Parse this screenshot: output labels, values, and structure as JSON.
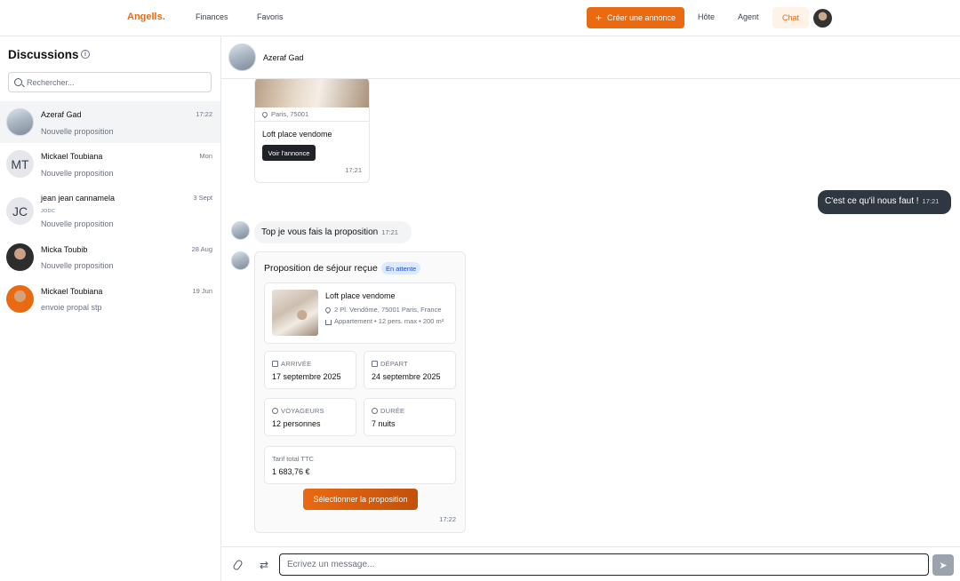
{
  "nav": {
    "logo": "Angells.",
    "links": [
      "Finances",
      "Favoris"
    ],
    "create_label": "Créer une annonce",
    "hote": "Hôte",
    "agent": "Agent",
    "chat": "Chat",
    "accent_color": "#ea6a12"
  },
  "sidebar": {
    "title": "Discussions",
    "search_placeholder": "Rechercher...",
    "conversations": [
      {
        "name": "Azeraf Gad",
        "time": "17:22",
        "sub": "",
        "message": "Nouvelle proposition",
        "avatar": "photo-building",
        "initials": ""
      },
      {
        "name": "Mickael Toubiana",
        "time": "Mon",
        "sub": "",
        "message": "Nouvelle proposition",
        "avatar": "initials",
        "initials": "MT"
      },
      {
        "name": "jean jean cannamela",
        "time": "3 Sept",
        "sub": "JODC",
        "message": "Nouvelle proposition",
        "avatar": "initials",
        "initials": "JC"
      },
      {
        "name": "Micka Toubib",
        "time": "28 Aug",
        "sub": "",
        "message": "Nouvelle proposition",
        "avatar": "photo-person",
        "initials": ""
      },
      {
        "name": "Mickael Toubiana",
        "time": "19 Jun",
        "sub": "",
        "message": "envoie propal stp",
        "avatar": "photo-person-orange",
        "initials": ""
      }
    ]
  },
  "chat": {
    "contact_name": "Azeraf Gad",
    "listing_card": {
      "location": "Paris, 75001",
      "title": "Loft place vendome",
      "button": "Voir l'annonce",
      "time": "17:21"
    },
    "outgoing": {
      "text": "C'est ce qu'il nous faut !",
      "time": "17:21"
    },
    "incoming": {
      "text": "Top je vous fais la proposition",
      "time": "17:21"
    },
    "proposal": {
      "title": "Proposition de séjour reçue",
      "status": "En attente",
      "listing_name": "Loft place vendome",
      "address": "2 Pl. Vendôme, 75001 Paris, France",
      "meta": "Appartement • 12 pers. max • 200 m²",
      "arrival_label": "ARRIVÉE",
      "arrival_value": "17 septembre 2025",
      "departure_label": "DÉPART",
      "departure_value": "24 septembre 2025",
      "guests_label": "VOYAGEURS",
      "guests_value": "12 personnes",
      "duration_label": "DURÉE",
      "duration_value": "7 nuits",
      "total_label": "Tarif total TTC",
      "total_value": "1 683,76 €",
      "select_button": "Sélectionner la proposition",
      "time": "17:22"
    },
    "composer_placeholder": "Écrivez un message..."
  }
}
